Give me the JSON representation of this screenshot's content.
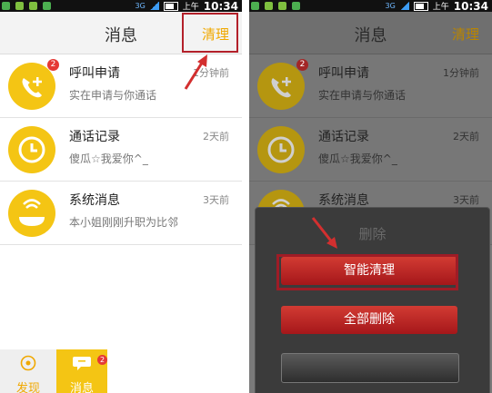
{
  "statusbar": {
    "network": "3G",
    "ampm": "上午",
    "time": "10:34"
  },
  "navbar": {
    "title": "消息",
    "action_label": "清理"
  },
  "conversations": [
    {
      "name": "呼叫申请",
      "preview": "实在申请与你通话",
      "time": "1分钟前",
      "badge": "2"
    },
    {
      "name": "通话记录",
      "preview": "傻瓜☆我爱你^_",
      "time": "2天前",
      "badge": ""
    },
    {
      "name": "系统消息",
      "preview": "本小姐刚刚升职为比邻",
      "time": "3天前",
      "badge": ""
    }
  ],
  "tabs": [
    {
      "label": "发现"
    },
    {
      "label": "消息",
      "badge": "2"
    }
  ],
  "dialog": {
    "title": "删除",
    "smart_clean_label": "智能清理",
    "delete_all_label": "全部删除"
  },
  "colors": {
    "accent": "#f4c514",
    "action": "#f0a800",
    "danger": "#c62828",
    "highlight_box": "#b3202a"
  },
  "icons": [
    "phone-plus-icon",
    "clock-icon",
    "whale-icon",
    "eye-icon",
    "chat-bubble-icon"
  ]
}
